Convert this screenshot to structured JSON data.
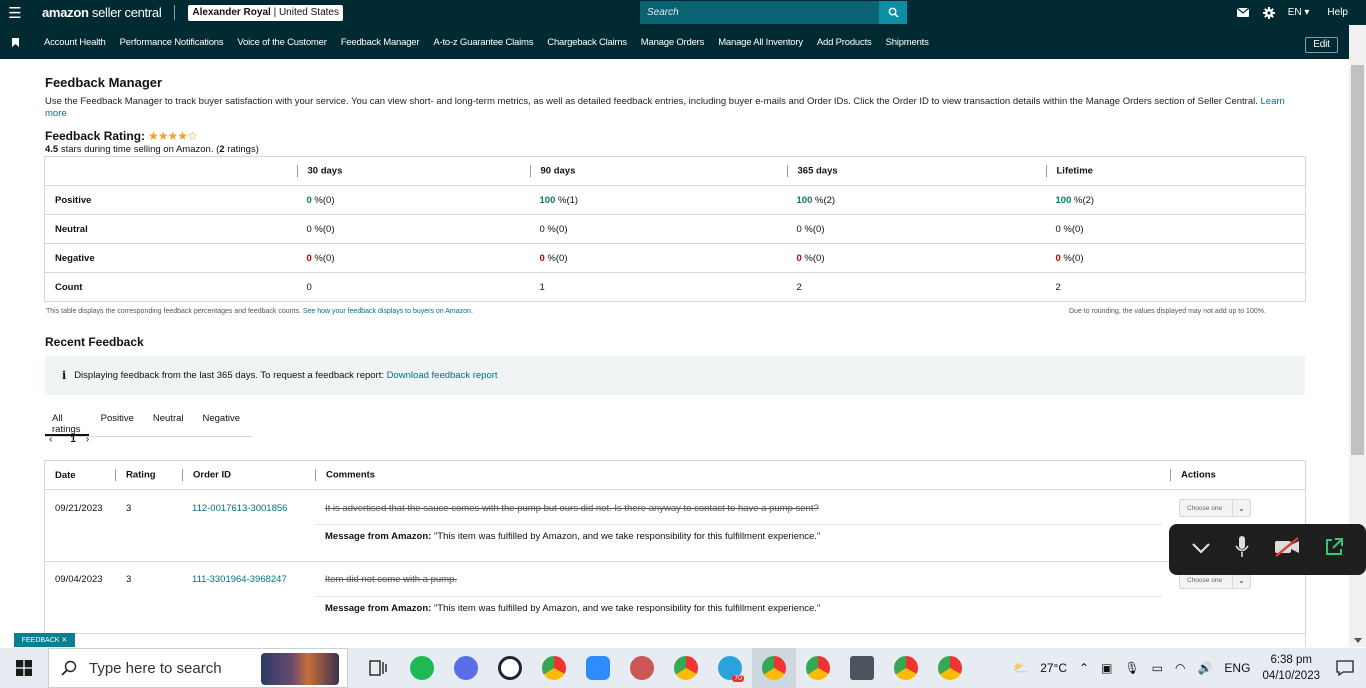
{
  "header": {
    "brand_bold": "amazon",
    "brand_light": " seller central",
    "account_name": "Alexander Royal",
    "account_region": " | United States",
    "search_placeholder": "Search",
    "language": "EN",
    "help": "Help"
  },
  "nav": {
    "items": [
      "Account Health",
      "Performance Notifications",
      "Voice of the Customer",
      "Feedback Manager",
      "A-to-z Guarantee Claims",
      "Chargeback Claims",
      "Manage Orders",
      "Manage All Inventory",
      "Add Products",
      "Shipments"
    ],
    "edit": "Edit"
  },
  "page": {
    "title": "Feedback Manager",
    "intro": "Use the Feedback Manager to track buyer satisfaction with your service. You can view short- and long-term metrics, as well as detailed feedback entries, including buyer e-mails and Order IDs. Click the Order ID to view transaction details within the Manage Orders section of Seller Central.",
    "learn_more": "Learn more",
    "rating_label": "Feedback Rating:",
    "rating_stars": 4.5,
    "rating_value": "4.5",
    "rating_text": " stars during time selling on Amazon. (",
    "rating_count": "2",
    "rating_count_suffix": " ratings)"
  },
  "metrics": {
    "columns": [
      "30 days",
      "90 days",
      "365 days",
      "Lifetime"
    ],
    "rows": [
      {
        "label": "Positive",
        "cells": [
          {
            "pct": "0",
            "count": " %(0)"
          },
          {
            "pct": "100",
            "count": " %(1)"
          },
          {
            "pct": "100",
            "count": " %(2)"
          },
          {
            "pct": "100",
            "count": " %(2)"
          }
        ]
      },
      {
        "label": "Neutral",
        "cells": [
          {
            "pct": "0",
            "count": " %(0)"
          },
          {
            "pct": "0",
            "count": " %(0)"
          },
          {
            "pct": "0",
            "count": " %(0)"
          },
          {
            "pct": "0",
            "count": " %(0)"
          }
        ]
      },
      {
        "label": "Negative",
        "cells": [
          {
            "pct": "0",
            "count": " %(0)"
          },
          {
            "pct": "0",
            "count": " %(0)"
          },
          {
            "pct": "0",
            "count": " %(0)"
          },
          {
            "pct": "0",
            "count": " %(0)"
          }
        ]
      },
      {
        "label": "Count",
        "cells": [
          {
            "pct": "0",
            "count": ""
          },
          {
            "pct": "1",
            "count": ""
          },
          {
            "pct": "2",
            "count": ""
          },
          {
            "pct": "2",
            "count": ""
          }
        ]
      }
    ],
    "note_text": "This table displays the corresponding feedback percentages and feedback counts. ",
    "note_link": "See how your feedback displays to buyers on Amazon.",
    "rounding_note": "Due to rounding, the values displayed may not add up to 100%."
  },
  "recent": {
    "title": "Recent Feedback",
    "info_text": "Displaying feedback from the last 365 days. To request a feedback report: ",
    "info_link": "Download feedback report",
    "tabs": [
      "All ratings",
      "Positive",
      "Neutral",
      "Negative"
    ],
    "page": "1",
    "columns": [
      "Date",
      "Rating",
      "Order ID",
      "Comments",
      "Actions"
    ],
    "rows": [
      {
        "date": "09/21/2023",
        "rating": "3",
        "order_id": "112-0017613-3001856",
        "comment": "It is advertised that the sauce comes with the pump but ours did not. Is there anyway to contact to have a pump sent?",
        "msg_label": "Message from Amazon:",
        "msg": " \"This item was fulfilled by Amazon, and we take responsibility for this fulfillment experience.\"",
        "action": "Choose one"
      },
      {
        "date": "09/04/2023",
        "rating": "3",
        "order_id": "111-3301964-3968247",
        "comment": "Item did not come with a pump.",
        "msg_label": "Message from Amazon:",
        "msg": " \"This item was fulfilled by Amazon, and we take responsibility for this fulfillment experience.\"",
        "action": "Choose one"
      }
    ]
  },
  "feedback_tab": "FEEDBACK ✕",
  "taskbar": {
    "search_placeholder": "Type here to search",
    "temperature": "27°C",
    "language": "ENG",
    "time": "6:38 pm",
    "date": "04/10/2023",
    "telegram_badge": "70"
  }
}
